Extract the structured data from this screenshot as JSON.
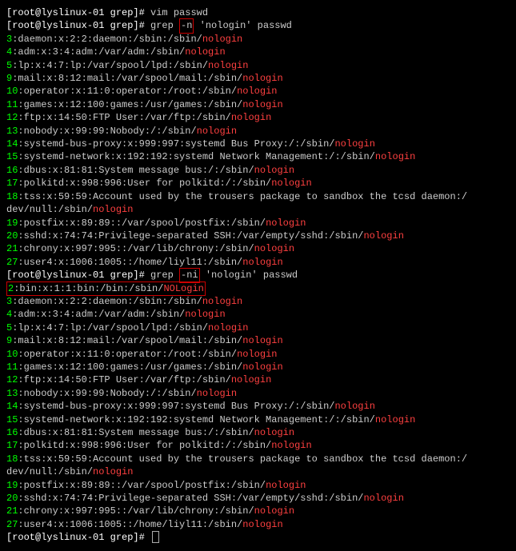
{
  "prompt": "[root@lyslinux-01 grep]# ",
  "cmd1": "vim passwd",
  "cmd2_a": "grep ",
  "cmd2_flag": "-n",
  "cmd2_b": " 'nologin' passwd",
  "cmd3_a": "grep ",
  "cmd3_flag": "-ni",
  "cmd3_b": " 'nologin' passwd",
  "b1": {
    "ln3": "3",
    "t3a": ":daemon:x:2:2:daemon:/sbin:/sbin/",
    "t3h": "nologin",
    "ln4": "4",
    "t4a": ":adm:x:3:4:adm:/var/adm:/sbin/",
    "t4h": "nologin",
    "ln5": "5",
    "t5a": ":lp:x:4:7:lp:/var/spool/lpd:/sbin/",
    "t5h": "nologin",
    "ln9": "9",
    "t9a": ":mail:x:8:12:mail:/var/spool/mail:/sbin/",
    "t9h": "nologin",
    "ln10": "10",
    "t10a": ":operator:x:11:0:operator:/root:/sbin/",
    "t10h": "nologin",
    "ln11": "11",
    "t11a": ":games:x:12:100:games:/usr/games:/sbin/",
    "t11h": "nologin",
    "ln12": "12",
    "t12a": ":ftp:x:14:50:FTP User:/var/ftp:/sbin/",
    "t12h": "nologin",
    "ln13": "13",
    "t13a": ":nobody:x:99:99:Nobody:/:/sbin/",
    "t13h": "nologin",
    "ln14": "14",
    "t14a": ":systemd-bus-proxy:x:999:997:systemd Bus Proxy:/:/sbin/",
    "t14h": "nologin",
    "ln15": "15",
    "t15a": ":systemd-network:x:192:192:systemd Network Management:/:/sbin/",
    "t15h": "nologin",
    "ln16": "16",
    "t16a": ":dbus:x:81:81:System message bus:/:/sbin/",
    "t16h": "nologin",
    "ln17": "17",
    "t17a": ":polkitd:x:998:996:User for polkitd:/:/sbin/",
    "t17h": "nologin",
    "ln18": "18",
    "t18a": ":tss:x:59:59:Account used by the trousers package to sandbox the tcsd daemon:/",
    "t18b": "dev/null:/sbin/",
    "t18h": "nologin",
    "ln19": "19",
    "t19a": ":postfix:x:89:89::/var/spool/postfix:/sbin/",
    "t19h": "nologin",
    "ln20": "20",
    "t20a": ":sshd:x:74:74:Privilege-separated SSH:/var/empty/sshd:/sbin/",
    "t20h": "nologin",
    "ln21": "21",
    "t21a": ":chrony:x:997:995::/var/lib/chrony:/sbin/",
    "t21h": "nologin",
    "ln27": "27",
    "t27a": ":user4:x:1006:1005::/home/liyl11:/sbin/",
    "t27h": "nologin"
  },
  "b2": {
    "ln2": "2",
    "t2a": ":bin:x:1:1:bin:/bin:/sbin/",
    "t2h": "NOLogin",
    "ln3": "3",
    "t3a": ":daemon:x:2:2:daemon:/sbin:/sbin/",
    "t3h": "nologin",
    "ln4": "4",
    "t4a": ":adm:x:3:4:adm:/var/adm:/sbin/",
    "t4h": "nologin",
    "ln5": "5",
    "t5a": ":lp:x:4:7:lp:/var/spool/lpd:/sbin/",
    "t5h": "nologin",
    "ln9": "9",
    "t9a": ":mail:x:8:12:mail:/var/spool/mail:/sbin/",
    "t9h": "nologin",
    "ln10": "10",
    "t10a": ":operator:x:11:0:operator:/root:/sbin/",
    "t10h": "nologin",
    "ln11": "11",
    "t11a": ":games:x:12:100:games:/usr/games:/sbin/",
    "t11h": "nologin",
    "ln12": "12",
    "t12a": ":ftp:x:14:50:FTP User:/var/ftp:/sbin/",
    "t12h": "nologin",
    "ln13": "13",
    "t13a": ":nobody:x:99:99:Nobody:/:/sbin/",
    "t13h": "nologin",
    "ln14": "14",
    "t14a": ":systemd-bus-proxy:x:999:997:systemd Bus Proxy:/:/sbin/",
    "t14h": "nologin",
    "ln15": "15",
    "t15a": ":systemd-network:x:192:192:systemd Network Management:/:/sbin/",
    "t15h": "nologin",
    "ln16": "16",
    "t16a": ":dbus:x:81:81:System message bus:/:/sbin/",
    "t16h": "nologin",
    "ln17": "17",
    "t17a": ":polkitd:x:998:996:User for polkitd:/:/sbin/",
    "t17h": "nologin",
    "ln18": "18",
    "t18a": ":tss:x:59:59:Account used by the trousers package to sandbox the tcsd daemon:/",
    "t18b": "dev/null:/sbin/",
    "t18h": "nologin",
    "ln19": "19",
    "t19a": ":postfix:x:89:89::/var/spool/postfix:/sbin/",
    "t19h": "nologin",
    "ln20": "20",
    "t20a": ":sshd:x:74:74:Privilege-separated SSH:/var/empty/sshd:/sbin/",
    "t20h": "nologin",
    "ln21": "21",
    "t21a": ":chrony:x:997:995::/var/lib/chrony:/sbin/",
    "t21h": "nologin",
    "ln27": "27",
    "t27a": ":user4:x:1006:1005::/home/liyl11:/sbin/",
    "t27h": "nologin"
  }
}
